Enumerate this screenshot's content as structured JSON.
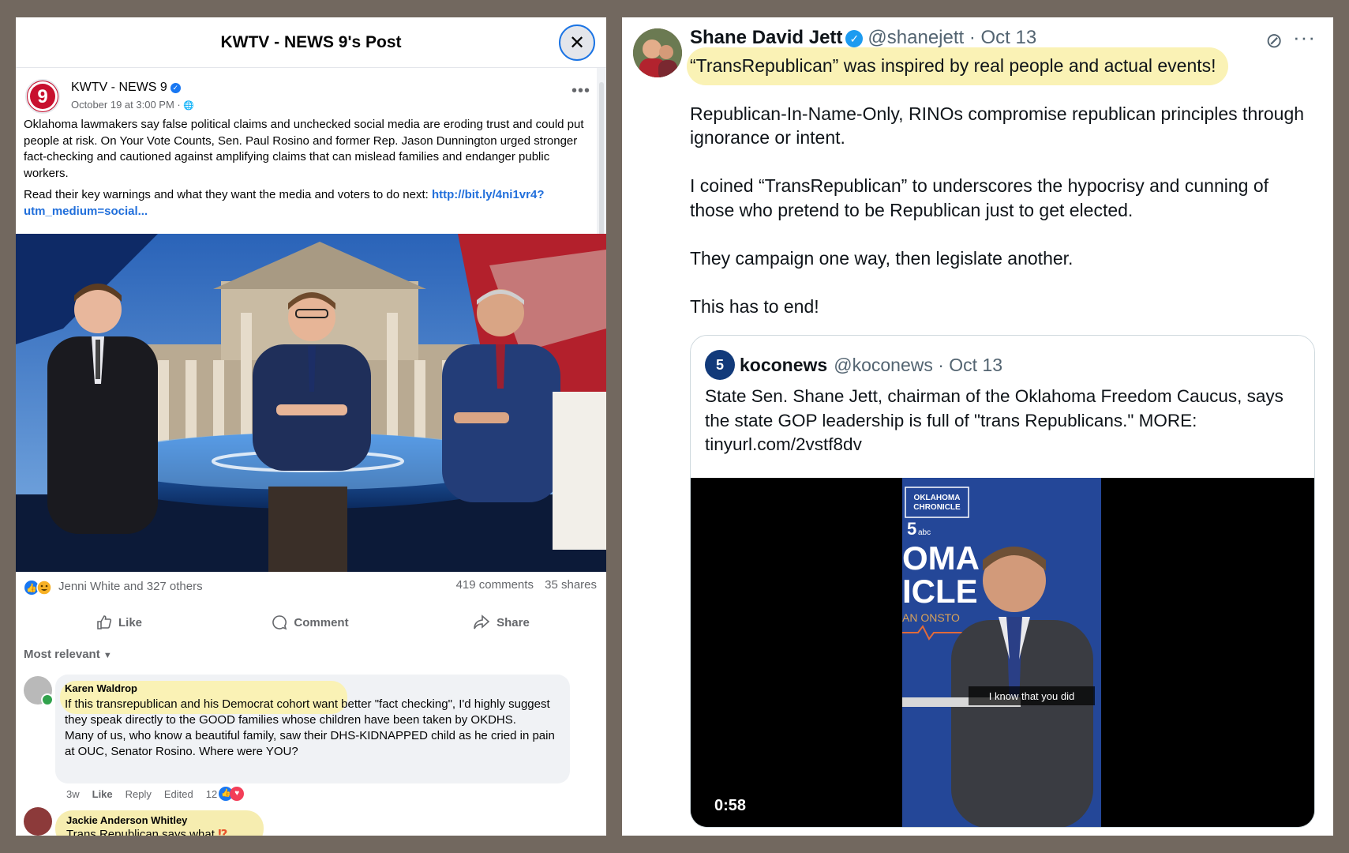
{
  "facebook": {
    "header_title": "KWTV - NEWS 9's Post",
    "close_glyph": "✕",
    "page_name": "KWTV - NEWS 9",
    "post_date": "October 19 at 3:00 PM · ",
    "globe_glyph": "🌐",
    "more_glyph": "•••",
    "post_paragraph_1": "Oklahoma lawmakers say false political claims and unchecked social media are eroding trust and could put people at risk. On Your Vote Counts, Sen. Paul Rosino and former Rep. Jason Dunnington urged stronger fact-checking and cautioned against amplifying claims that can mislead families and endanger public workers.",
    "post_paragraph_2_prefix": "Read their key warnings and what they want the media and voters to do next: ",
    "post_link": "http://bit.ly/4ni1vr4?utm_medium=social...",
    "reactors": "Jenni White and 327 others",
    "comments_count": "419 comments",
    "shares_count": "35 shares",
    "actions": {
      "like": "Like",
      "comment": "Comment",
      "share": "Share"
    },
    "sort_label": "Most relevant",
    "comments": [
      {
        "author": "Karen Waldrop",
        "text_1": "If this transrepublican and his Democrat cohort want better \"fact checking\", I'd highly suggest they speak directly to the GOOD families whose children have been taken by OKDHS.",
        "text_2": "Many of us, who know a beautiful family, saw their DHS-KIDNAPPED child as he cried in pain at OUC, Senator Rosino. Where were YOU?",
        "age": "3w",
        "like": "Like",
        "reply": "Reply",
        "edited": "Edited",
        "reaction_count": "12"
      },
      {
        "author": "Jackie Anderson Whitley",
        "text": "Trans Republican says what",
        "emoji": "⁉"
      }
    ],
    "colors": {
      "link": "#216fdb",
      "highlight": "#faf2b5",
      "like_blue": "#1877f2"
    }
  },
  "tweet": {
    "author_name": "Shane David Jett",
    "handle_date": "@shanejett · Oct 13",
    "verified_glyph": "✓",
    "highlighted_line": "“TransRepublican” was inspired by real people and actual events!",
    "paragraphs": [
      "Republican-In-Name-Only, RINOs compromise republican principles through ignorance or intent.",
      "I coined “TransRepublican” to underscores the hypocrisy and cunning of those who pretend to be Republican just to get elected.",
      "They campaign one way, then legislate another.",
      "This has to end!"
    ],
    "grok_glyph": "⊘",
    "more_glyph": "···",
    "quote": {
      "logo_text": "5",
      "name": "koconews",
      "handle_date": "@koconews · Oct 13",
      "text": "State Sen. Shane Jett, chairman of the Oklahoma Freedom Caucus, says the state GOP leadership is full of \"trans Republicans.\" MORE: tinyurl.com/2vstf8dv",
      "video_duration": "0:58",
      "caption": "I know that you did",
      "video_overlay": {
        "chronicle_1": "OKLAHOMA",
        "chronicle_2": "CHRONICLE",
        "big_1": "OMA",
        "big_2": "ICLE",
        "sub": "AN ONSTO",
        "abc": "abc"
      }
    },
    "colors": {
      "verified": "#1d9bf0",
      "muted": "#536471",
      "highlight": "#faf2b5"
    }
  }
}
